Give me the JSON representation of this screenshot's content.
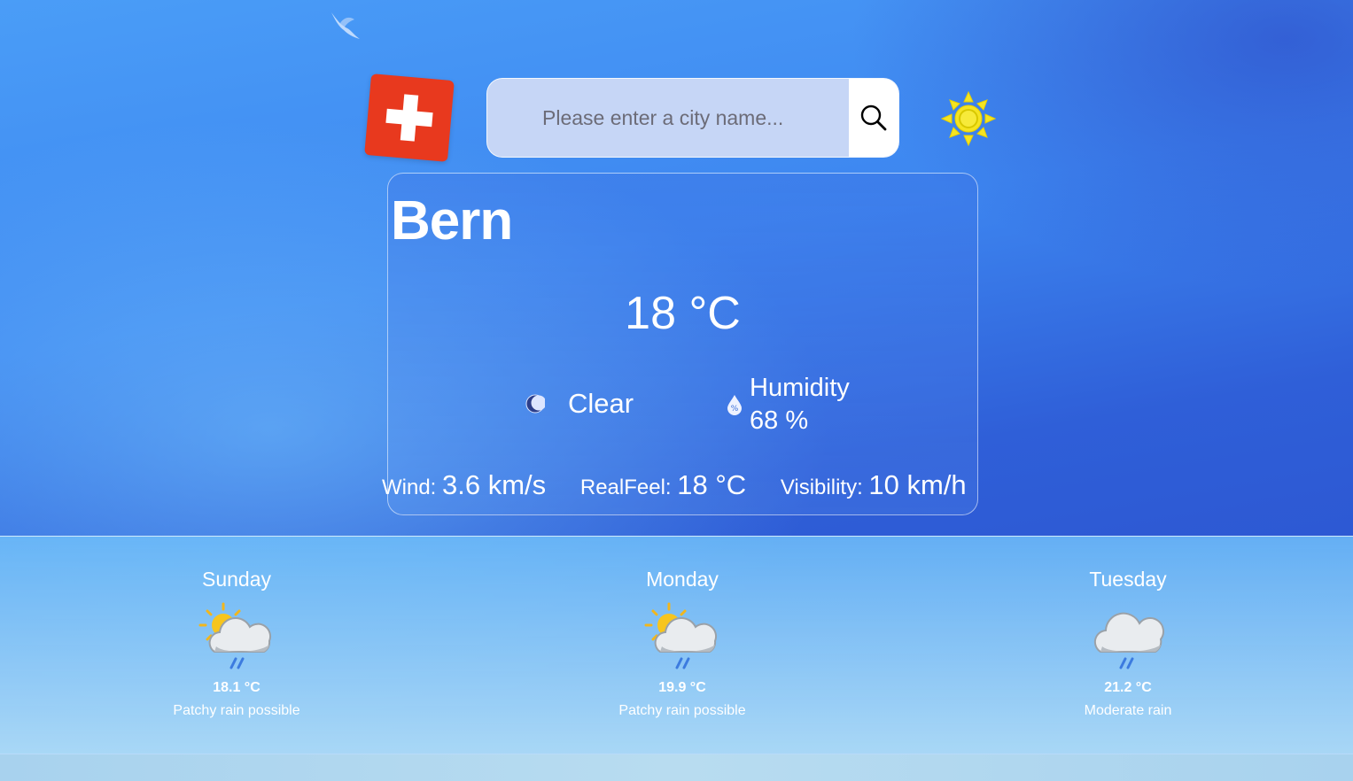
{
  "search": {
    "placeholder": "Please enter a city name..."
  },
  "icons": {
    "flag": "swiss-flag-icon",
    "search": "search-icon",
    "theme": "sun-icon",
    "condition": "moon-icon",
    "humidity": "humidity-drop-icon",
    "forecast": [
      "sun-cloud-rain-icon",
      "sun-cloud-rain-icon",
      "cloud-rain-icon"
    ]
  },
  "colors": {
    "flag": "#e8391e",
    "sun": "#f5e422"
  },
  "current": {
    "city": "Bern",
    "temperature": "18 °C",
    "condition": "Clear",
    "humidity_label": "Humidity",
    "humidity_value": "68 %",
    "wind_label": "Wind:",
    "wind_value": "3.6 km/s",
    "realfeel_label": "RealFeel:",
    "realfeel_value": "18 °C",
    "visibility_label": "Visibility:",
    "visibility_value": "10 km/h"
  },
  "forecast": [
    {
      "day": "Sunday",
      "temp": "18.1 °C",
      "desc": "Patchy rain possible"
    },
    {
      "day": "Monday",
      "temp": "19.9 °C",
      "desc": "Patchy rain possible"
    },
    {
      "day": "Tuesday",
      "temp": "21.2 °C",
      "desc": "Moderate rain"
    }
  ]
}
